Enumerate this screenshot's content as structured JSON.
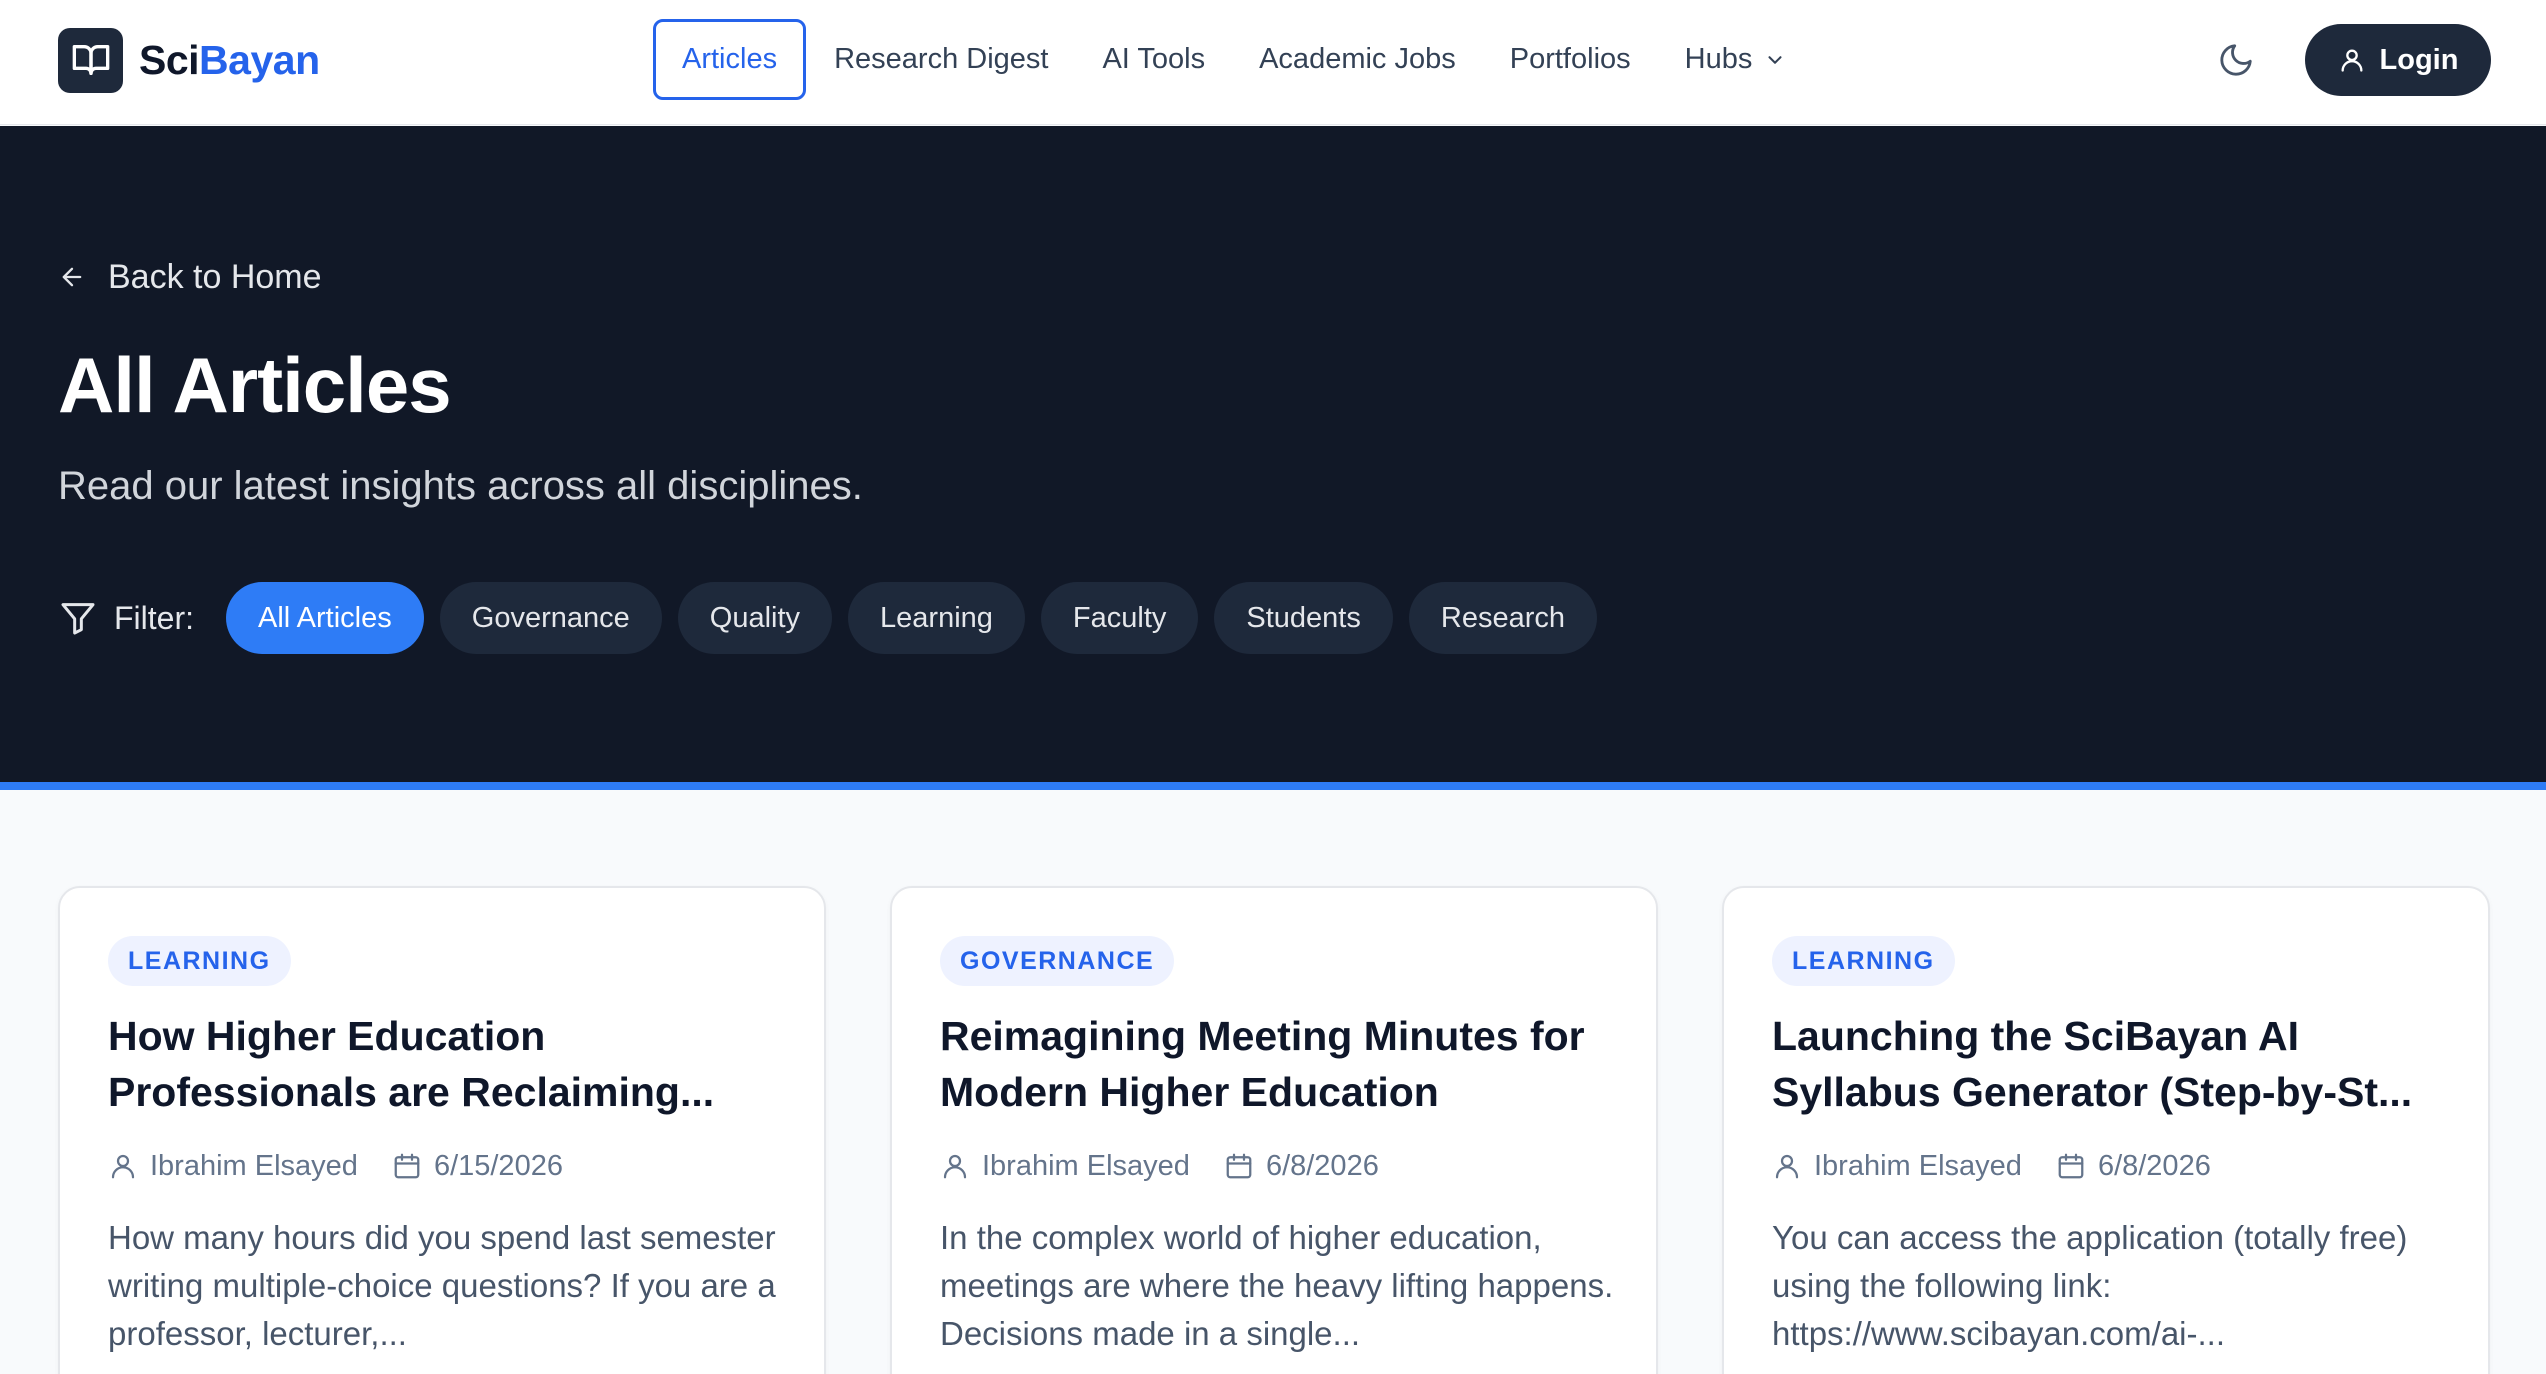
{
  "brand": {
    "part1": "Sci",
    "part2": "Bayan"
  },
  "nav": {
    "items": [
      {
        "label": "Articles"
      },
      {
        "label": "Research Digest"
      },
      {
        "label": "AI Tools"
      },
      {
        "label": "Academic Jobs"
      },
      {
        "label": "Portfolios"
      },
      {
        "label": "Hubs"
      }
    ],
    "login_label": "Login"
  },
  "hero": {
    "back_label": "Back to Home",
    "title": "All Articles",
    "subtitle": "Read our latest insights across all disciplines.",
    "filter_label": "Filter:",
    "filters": [
      {
        "label": "All Articles"
      },
      {
        "label": "Governance"
      },
      {
        "label": "Quality"
      },
      {
        "label": "Learning"
      },
      {
        "label": "Faculty"
      },
      {
        "label": "Students"
      },
      {
        "label": "Research"
      }
    ]
  },
  "articles": [
    {
      "tag": "LEARNING",
      "title": "How Higher Education Professionals are Reclaiming...",
      "author": "Ibrahim Elsayed",
      "date": "6/15/2026",
      "excerpt": "How many hours did you spend last semester writing multiple-choice questions? If you are a professor, lecturer,..."
    },
    {
      "tag": "GOVERNANCE",
      "title": "Reimagining Meeting Minutes for Modern Higher Education",
      "author": "Ibrahim Elsayed",
      "date": "6/8/2026",
      "excerpt": "In the complex world of higher education, meetings are where the heavy lifting happens. Decisions made in a single..."
    },
    {
      "tag": "LEARNING",
      "title": "Launching the SciBayan AI Syllabus Generator (Step-by-St...",
      "author": "Ibrahim Elsayed",
      "date": "6/8/2026",
      "excerpt": "You can access the application (totally free) using the following link: https://www.scibayan.com/ai-..."
    }
  ],
  "colors": {
    "accent": "#2e7cf6",
    "brand_blue": "#2563eb",
    "hero_bg": "#111827",
    "dark_button": "#1e293b"
  },
  "icons": {
    "logo": "book-open-icon",
    "hubs": "chevron-down-icon",
    "theme": "moon-icon",
    "login": "user-icon",
    "back": "arrow-left-icon",
    "filter": "filter-icon",
    "author": "user-icon",
    "date": "calendar-icon"
  }
}
